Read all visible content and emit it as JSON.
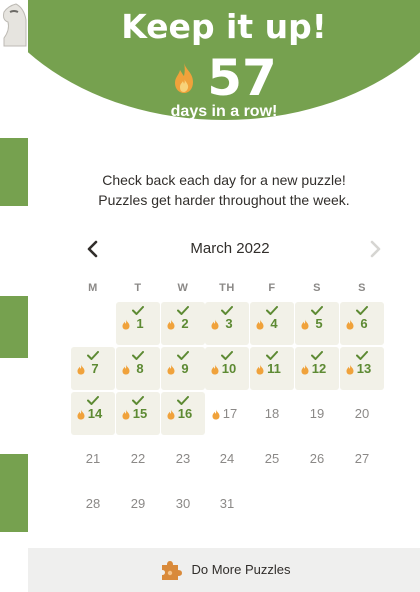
{
  "colors": {
    "accent": "#76a14f",
    "done_text": "#5d8a33",
    "done_cell": "#f2f1e8",
    "muted": "#8b8987",
    "text": "#312e2b",
    "flame": "#f0a23b"
  },
  "header": {
    "title": "Keep it up!",
    "streak_count": "57",
    "streak_subtitle": "days in a row!"
  },
  "intro": {
    "line1": "Check back each day for a new puzzle!",
    "line2": "Puzzles get harder throughout the week."
  },
  "calendar": {
    "month_label": "March 2022",
    "weekdays": [
      "M",
      "T",
      "W",
      "TH",
      "F",
      "S",
      "S"
    ],
    "start_offset": 1,
    "days_in_month": 31,
    "completed_days": [
      1,
      2,
      3,
      4,
      5,
      6,
      7,
      8,
      9,
      10,
      11,
      12,
      13,
      14,
      15,
      16
    ],
    "today": 17
  },
  "footer": {
    "label": "Do More Puzzles",
    "icon": "puzzle-piece-icon"
  }
}
